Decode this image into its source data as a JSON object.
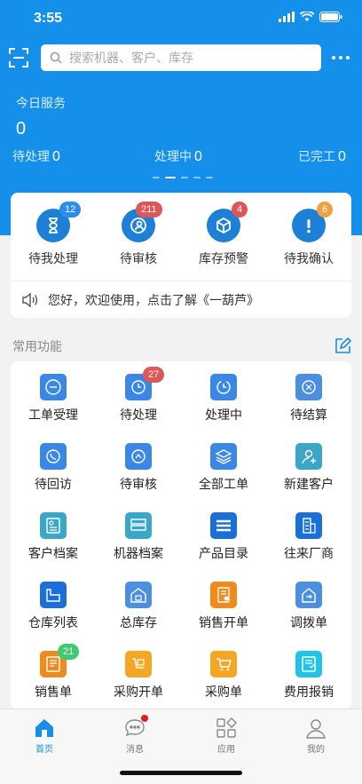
{
  "status": {
    "time": "3:55"
  },
  "search": {
    "placeholder": "搜索机器、客户、库存"
  },
  "today": {
    "title": "今日服务",
    "count": "0",
    "stats": [
      {
        "label": "待处理",
        "value": "0"
      },
      {
        "label": "处理中",
        "value": "0"
      },
      {
        "label": "已完工",
        "value": "0"
      }
    ]
  },
  "quick": [
    {
      "label": "待我处理",
      "badge": "12",
      "badge_color": "#2d8cf0",
      "icon": "hourglass-icon"
    },
    {
      "label": "待审核",
      "badge": "211",
      "badge_color": "#e05555",
      "icon": "user-review-icon"
    },
    {
      "label": "库存预警",
      "badge": "4",
      "badge_color": "#e05555",
      "icon": "box-icon"
    },
    {
      "label": "待我确认",
      "badge": "6",
      "badge_color": "#f0a040",
      "icon": "exclamation-icon"
    }
  ],
  "notice": {
    "text": "您好，欢迎使用，点击了解《一葫芦》"
  },
  "section": {
    "title": "常用功能"
  },
  "functions": [
    {
      "label": "工单受理",
      "color": "#3a87e8",
      "icon": "ticket-icon",
      "badge": ""
    },
    {
      "label": "待处理",
      "color": "#3a87e8",
      "icon": "pending-icon",
      "badge": "27"
    },
    {
      "label": "处理中",
      "color": "#3a87e8",
      "icon": "clock-icon",
      "badge": ""
    },
    {
      "label": "待结算",
      "color": "#4a8fe0",
      "icon": "settle-icon",
      "badge": ""
    },
    {
      "label": "待回访",
      "color": "#3a87e8",
      "icon": "phone-icon",
      "badge": ""
    },
    {
      "label": "待审核",
      "color": "#3a87e8",
      "icon": "review-icon",
      "badge": ""
    },
    {
      "label": "全部工单",
      "color": "#3a87e8",
      "icon": "layers-icon",
      "badge": ""
    },
    {
      "label": "新建客户",
      "color": "#3aa6c8",
      "icon": "add-user-icon",
      "badge": ""
    },
    {
      "label": "客户档案",
      "color": "#3aa6c8",
      "icon": "customer-file-icon",
      "badge": ""
    },
    {
      "label": "机器档案",
      "color": "#3aa6c8",
      "icon": "machine-file-icon",
      "badge": ""
    },
    {
      "label": "产品目录",
      "color": "#1a6fd8",
      "icon": "catalog-icon",
      "badge": ""
    },
    {
      "label": "往来厂商",
      "color": "#1a6fd8",
      "icon": "vendor-icon",
      "badge": ""
    },
    {
      "label": "仓库列表",
      "color": "#1a6fd8",
      "icon": "warehouse-icon",
      "badge": ""
    },
    {
      "label": "总库存",
      "color": "#4a8fe0",
      "icon": "stock-icon",
      "badge": ""
    },
    {
      "label": "销售开单",
      "color": "#f08a1c",
      "icon": "sales-order-icon",
      "badge": ""
    },
    {
      "label": "调拨单",
      "color": "#4a8fe0",
      "icon": "transfer-icon",
      "badge": ""
    },
    {
      "label": "销售单",
      "color": "#f08a1c",
      "icon": "sales-icon",
      "badge": "21"
    },
    {
      "label": "采购开单",
      "color": "#f5a623",
      "icon": "purchase-order-icon",
      "badge": ""
    },
    {
      "label": "采购单",
      "color": "#f5a623",
      "icon": "cart-icon",
      "badge": ""
    },
    {
      "label": "费用报销",
      "color": "#22c3e6",
      "icon": "expense-icon",
      "badge": ""
    }
  ],
  "tabs": [
    {
      "label": "首页",
      "icon": "home-icon",
      "active": true
    },
    {
      "label": "消息",
      "icon": "message-icon",
      "active": false
    },
    {
      "label": "应用",
      "icon": "apps-icon",
      "active": false
    },
    {
      "label": "我的",
      "icon": "profile-icon",
      "active": false
    }
  ]
}
